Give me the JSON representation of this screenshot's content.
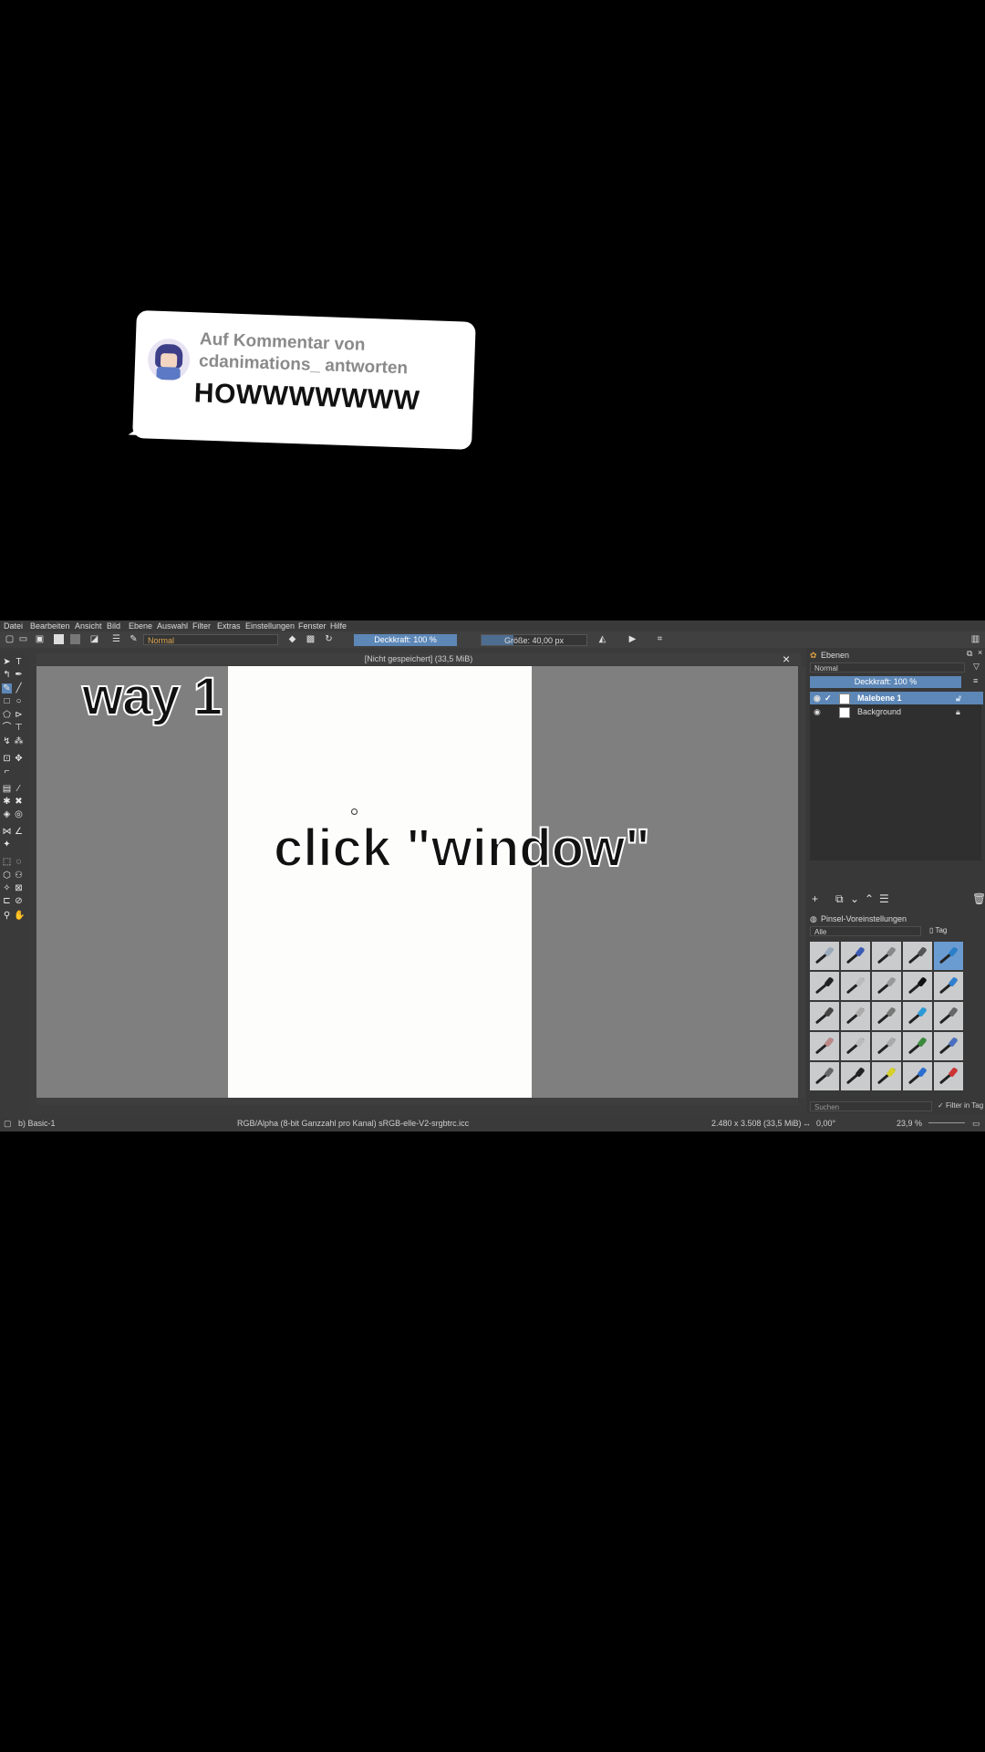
{
  "comment": {
    "reply_to": "Auf Kommentar von cdanimations_ antworten",
    "text": "HOWWWWWWW"
  },
  "krita": {
    "menu": [
      "Datei",
      "Bearbeiten",
      "Ansicht",
      "Bild",
      "Ebene",
      "Auswahl",
      "Filter",
      "Extras",
      "Einstellungen",
      "Fenster",
      "Hilfe"
    ],
    "toolbar": {
      "blend_mode": "Normal",
      "opacity_label": "Deckkraft: 100 %",
      "size_label": "Größe: 40,00 px",
      "size_fraction": 0.3
    },
    "document_title": "[Nicht gespeichert]  (33,5 MiB)",
    "layers_docker": {
      "title": "Ebenen",
      "blend_mode": "Normal",
      "opacity_label": "Deckkraft:  100 %",
      "layers": [
        {
          "name": "Malebene 1",
          "selected": true
        },
        {
          "name": "Background",
          "selected": false
        }
      ]
    },
    "brush_docker": {
      "title": "Pinsel-Voreinstellungen",
      "filter": "Alle",
      "tag_label": "Tag",
      "search_placeholder": "Suchen",
      "filter_in_tag": "Filter in Tag"
    },
    "statusbar": {
      "brush_name": "b) Basic-1",
      "color_info": "RGB/Alpha (8-bit Ganzzahl pro Kanal)  sRGB-elle-V2-srgbtrc.icc",
      "image_size": "2.480 x 3.508 (33,5 MiB)",
      "rotation": "0,00°",
      "zoom": "23,9 %"
    }
  },
  "captions": {
    "way": "way 1",
    "instruction": "click \"window\""
  },
  "colors": {
    "accent": "#5c87b7",
    "canvas_bg": "#7f7f7f",
    "ui_bg": "#3b3b3b"
  }
}
